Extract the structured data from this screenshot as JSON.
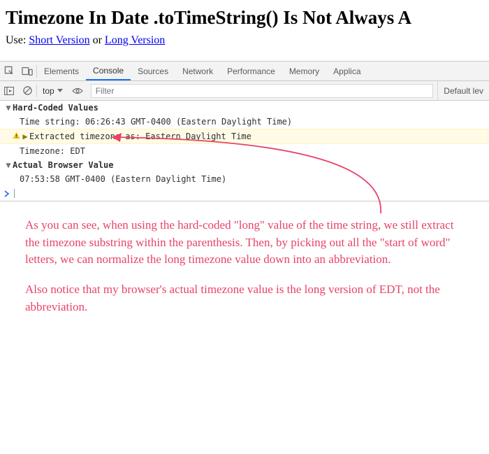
{
  "header": {
    "title": "Timezone In Date .toTimeString() Is Not Always A",
    "use_label": "Use:",
    "short_link": "Short Version",
    "or": " or ",
    "long_link": "Long Version"
  },
  "devtools": {
    "tabs": {
      "elements": "Elements",
      "console": "Console",
      "sources": "Sources",
      "network": "Network",
      "performance": "Performance",
      "memory": "Memory",
      "application": "Applica"
    },
    "toolbar": {
      "context": "top",
      "filter_placeholder": "Filter",
      "level": "Default lev"
    },
    "console": {
      "group1_title": "Hard-Coded Values",
      "line1": "Time string: 06:26:43 GMT-0400 (Eastern Daylight Time)",
      "line2": "Extracted timezone as: Eastern Daylight Time",
      "line3": "Timezone: EDT",
      "group2_title": "Actual Browser Value",
      "line4": "07:53:58 GMT-0400 (Eastern Daylight Time)"
    }
  },
  "annotation": {
    "p1": "As you can see, when using the hard-coded \"long\" value of the time string, we still extract the timezone substring within the parenthesis. Then, by picking out all the \"start of word\" letters, we can normalize the long timezone value down into an abbreviation.",
    "p2": "Also notice that my browser's actual timezone value is the long version of EDT, not the abbreviation."
  }
}
